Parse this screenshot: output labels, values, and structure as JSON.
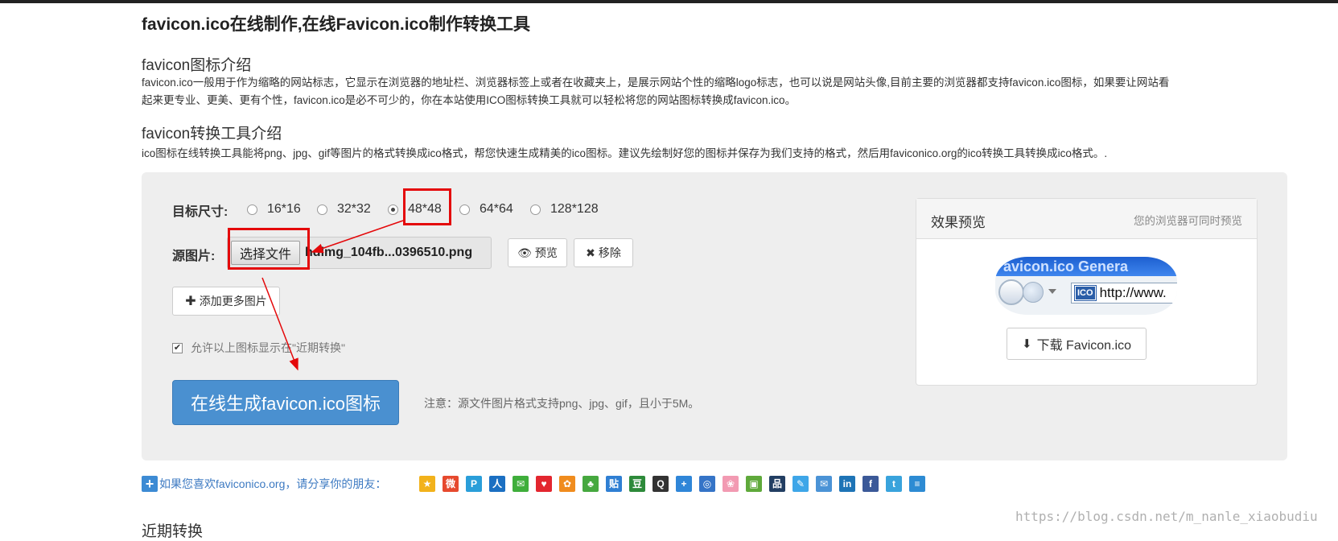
{
  "page": {
    "title": "favicon.ico在线制作,在线Favicon.ico制作转换工具"
  },
  "intro": {
    "heading": "favicon图标介绍",
    "line1": "favicon.ico一般用于作为缩略的网站标志，它显示在浏览器的地址栏、浏览器标签上或者在收藏夹上，是展示网站个性的缩略logo标志，也可以说是网站头像,目前主要的浏览器都支持favicon.ico图标，如果要让网站看",
    "line2": "起来更专业、更美、更有个性，favicon.ico是必不可少的，你在本站使用ICO图标转换工具就可以轻松将您的网站图标转换成favicon.ico。"
  },
  "tool_intro": {
    "heading": "favicon转换工具介绍",
    "text": "ico图标在线转换工具能将png、jpg、gif等图片的格式转换成ico格式，帮您快速生成精美的ico图标。建议先绘制好您的图标并保存为我们支持的格式，然后用faviconico.org的ico转换工具转换成ico格式。."
  },
  "form": {
    "size_label": "目标尺寸:",
    "sizes": [
      {
        "label": "16*16",
        "selected": false
      },
      {
        "label": "32*32",
        "selected": false
      },
      {
        "label": "48*48",
        "selected": true
      },
      {
        "label": "64*64",
        "selected": false
      },
      {
        "label": "128*128",
        "selected": false
      }
    ],
    "source_label": "源图片:",
    "file_button": "选择文件",
    "file_name": "hdlmg_104fb...0396510.png",
    "preview_button": "预览",
    "remove_button": "移除",
    "add_more_button": "添加更多图片",
    "allow_checkbox": "允许以上图标显示在\"近期转换\"",
    "allow_checked": true,
    "generate_button": "在线生成favicon.ico图标",
    "note": "注意：源文件图片格式支持png、jpg、gif，且小于5M。"
  },
  "preview": {
    "title": "效果预览",
    "subtitle": "您的浏览器可同时预览",
    "browser_banner": "avicon.ico Genera",
    "ico_badge": "ICO",
    "address_text": "http://www.",
    "download_button": "下载 Favicon.ico"
  },
  "share": {
    "text": "如果您喜欢faviconico.org，请分享你的朋友：",
    "icons": [
      {
        "name": "qzone-icon",
        "color": "#f2b21b"
      },
      {
        "name": "weibo-icon",
        "color": "#e6492e"
      },
      {
        "name": "tencent-weibo-icon",
        "color": "#2a9ed9"
      },
      {
        "name": "renren-icon",
        "color": "#1b6fc2"
      },
      {
        "name": "wechat-icon",
        "color": "#3fae3b"
      },
      {
        "name": "heart-icon",
        "color": "#e3262f"
      },
      {
        "name": "gift-icon",
        "color": "#f08c1e"
      },
      {
        "name": "clover-icon",
        "color": "#46a83f"
      },
      {
        "name": "tieba-icon",
        "color": "#2f7fd3"
      },
      {
        "name": "douban-icon",
        "color": "#2d8a3a"
      },
      {
        "name": "qq-icon",
        "color": "#333333"
      },
      {
        "name": "plus-icon",
        "color": "#2f86d8"
      },
      {
        "name": "kaixin-icon",
        "color": "#3574c7"
      },
      {
        "name": "flower-icon",
        "color": "#f29ab2"
      },
      {
        "name": "picture-icon",
        "color": "#5fa93b"
      },
      {
        "name": "network-icon",
        "color": "#223e62"
      },
      {
        "name": "pen-icon",
        "color": "#3ea6e8"
      },
      {
        "name": "mail-icon",
        "color": "#4b93d6"
      },
      {
        "name": "linkedin-icon",
        "color": "#1e74b6"
      },
      {
        "name": "facebook-icon",
        "color": "#3b5998"
      },
      {
        "name": "twitter-icon",
        "color": "#39a3dc"
      },
      {
        "name": "list-icon",
        "color": "#2d8bd3"
      }
    ]
  },
  "recent": {
    "heading": "近期转换"
  },
  "watermark": "https://blog.csdn.net/m_nanle_xiaobudiu",
  "colors": {
    "primary": "#4a90d0",
    "annotation": "#e4080a",
    "panel": "#eeeeee",
    "share_text": "#3d7ac2"
  }
}
